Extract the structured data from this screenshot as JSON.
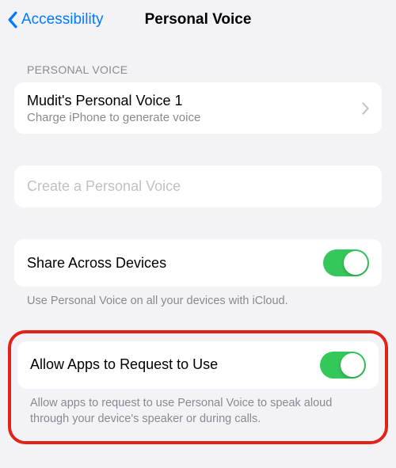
{
  "nav": {
    "back_label": "Accessibility",
    "title": "Personal Voice"
  },
  "section1": {
    "header": "PERSONAL VOICE",
    "voice_name": "Mudit's Personal Voice 1",
    "voice_status": "Charge iPhone to generate voice"
  },
  "create": {
    "placeholder": "Create a Personal Voice"
  },
  "share": {
    "label": "Share Across Devices",
    "footer": "Use Personal Voice on all your devices with iCloud."
  },
  "allow": {
    "label": "Allow Apps to Request to Use",
    "footer": "Allow apps to request to use Personal Voice to speak aloud through your device's speaker or during calls."
  }
}
